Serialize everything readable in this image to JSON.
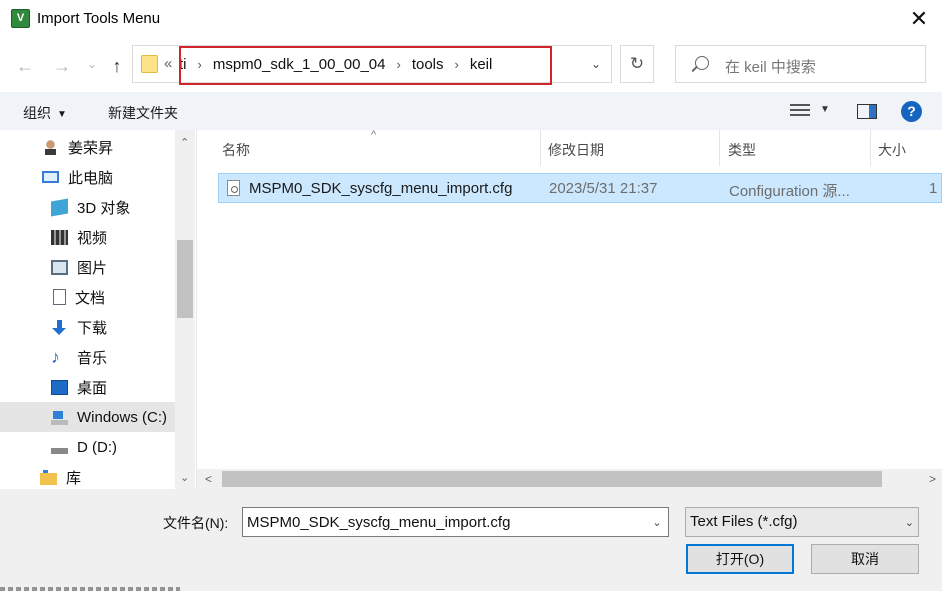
{
  "window": {
    "title": "Import Tools Menu",
    "app_icon_glyph": "V",
    "close_glyph": "✕"
  },
  "nav": {
    "back_glyph": "←",
    "forward_glyph": "→",
    "recent_glyph": "⌄",
    "up_glyph": "↑",
    "overflow_glyph": "«",
    "breadcrumb": [
      "ti",
      "mspm0_sdk_1_00_00_04",
      "tools",
      "keil"
    ],
    "breadcrumb_sep": "›",
    "dropdown_glyph": "⌄",
    "refresh_glyph": "↻",
    "search_placeholder": "在 keil 中搜索"
  },
  "toolbar": {
    "organize_label": "组织",
    "organize_caret": "▼",
    "new_folder_label": "新建文件夹",
    "view_caret": "▼",
    "help_glyph": "?"
  },
  "sidebar": {
    "up_glyph": "⌃",
    "down_glyph": "⌄",
    "items": [
      {
        "label": "姜荣昇",
        "icon": "user-icon"
      },
      {
        "label": "此电脑",
        "icon": "computer-icon"
      },
      {
        "label": "3D 对象",
        "icon": "cube-3d-icon"
      },
      {
        "label": "视频",
        "icon": "video-icon"
      },
      {
        "label": "图片",
        "icon": "pictures-icon"
      },
      {
        "label": "文档",
        "icon": "documents-icon"
      },
      {
        "label": "下载",
        "icon": "download-icon"
      },
      {
        "label": "音乐",
        "icon": "music-icon"
      },
      {
        "label": "桌面",
        "icon": "desktop-icon"
      },
      {
        "label": "Windows (C:)",
        "icon": "system-drive-icon",
        "selected": true
      },
      {
        "label": "D (D:)",
        "icon": "drive-icon"
      },
      {
        "label": "库",
        "icon": "library-icon"
      }
    ],
    "music_glyph": "♪"
  },
  "filelist": {
    "sort_glyph": "^",
    "columns": [
      "名称",
      "修改日期",
      "类型",
      "大小"
    ],
    "rows": [
      {
        "name": "MSPM0_SDK_syscfg_menu_import.cfg",
        "modified": "2023/5/31 21:37",
        "type": "Configuration 源...",
        "size": "1"
      }
    ],
    "hscroll_left": "<",
    "hscroll_right": ">"
  },
  "footer": {
    "filename_label": "文件名(N):",
    "filename_value": "MSPM0_SDK_syscfg_menu_import.cfg",
    "filename_dd": "⌄",
    "filetype_value": "Text Files (*.cfg)",
    "filetype_dd": "⌄",
    "open_label": "打开(O)",
    "cancel_label": "取消"
  },
  "colors": {
    "selection_bg": "#cce8ff",
    "highlight_border": "#d0252b",
    "primary_button_border": "#0078d7"
  }
}
